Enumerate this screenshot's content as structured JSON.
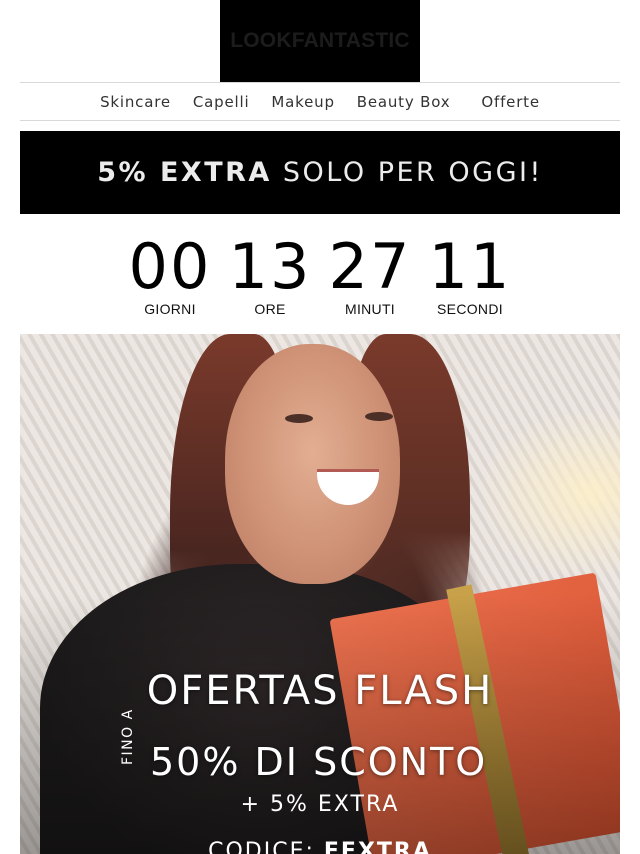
{
  "brand": {
    "logo_text": "LOOKFANTASTIC"
  },
  "nav": {
    "items": [
      "Skincare",
      "Capelli",
      "Makeup",
      "Beauty Box",
      "Offerte"
    ]
  },
  "banner": {
    "bold_text": "5% EXTRA",
    "rest_text": "SOLO PER OGGI!"
  },
  "countdown": {
    "days": {
      "value": "00",
      "label": "GIORNI"
    },
    "hours": {
      "value": "13",
      "label": "ORE"
    },
    "minutes": {
      "value": "27",
      "label": "MINUTI"
    },
    "seconds": {
      "value": "11",
      "label": "SECONDI"
    }
  },
  "hero": {
    "title": "OFERTAS FLASH",
    "prefix": "FINO A",
    "discount": "50% DI SCONTO",
    "extra": "+ 5% EXTRA",
    "code_label": "CODICE:",
    "code_value": "EEXTRA"
  },
  "colors": {
    "banner_bg": "#000000",
    "banner_text": "#ececec",
    "logo_bg": "#000000"
  }
}
